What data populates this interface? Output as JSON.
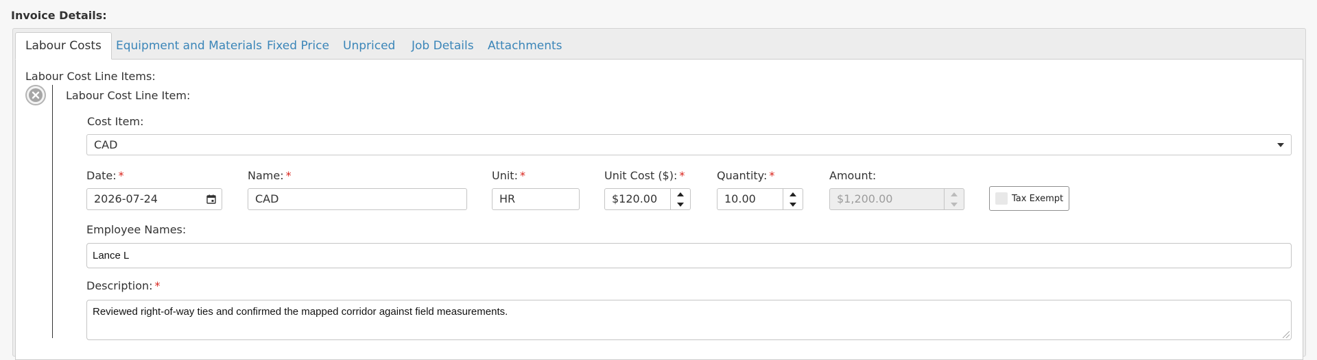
{
  "section": {
    "title": "Invoice Details:"
  },
  "tabs": [
    {
      "label": "Labour Costs",
      "active": true
    },
    {
      "label": "Equipment and Materials"
    },
    {
      "label": "Fixed Price"
    },
    {
      "label": "Unpriced"
    },
    {
      "label": "Job Details"
    },
    {
      "label": "Attachments"
    }
  ],
  "labour": {
    "group_label": "Labour Cost Line Items:",
    "item_label": "Labour Cost Line Item:",
    "cost_item": {
      "label": "Cost Item:",
      "value": "CAD"
    },
    "date": {
      "label": "Date:",
      "value": "2026-07-24"
    },
    "name": {
      "label": "Name:",
      "value": "CAD"
    },
    "unit": {
      "label": "Unit:",
      "value": "HR"
    },
    "unit_cost": {
      "label": "Unit Cost ($):",
      "value": "$120.00"
    },
    "quantity": {
      "label": "Quantity:",
      "value": "10.00"
    },
    "amount": {
      "label": "Amount:",
      "value": "$1,200.00"
    },
    "tax_exempt": {
      "label": "Tax Exempt",
      "checked": false
    },
    "employee_names": {
      "label": "Employee Names:",
      "value": "Lance L"
    },
    "description": {
      "label": "Description:",
      "value": "Reviewed right-of-way ties and confirmed the mapped corridor against field measurements."
    },
    "required_marker": "*"
  },
  "icons": {
    "remove": "remove-circle-icon",
    "calendar": "calendar-icon",
    "spinner_up": "chevron-up-icon",
    "spinner_down": "chevron-down-icon",
    "select_caret": "caret-down-icon"
  },
  "colors": {
    "tab_link": "#3a85b8",
    "required": "#d9241c"
  }
}
